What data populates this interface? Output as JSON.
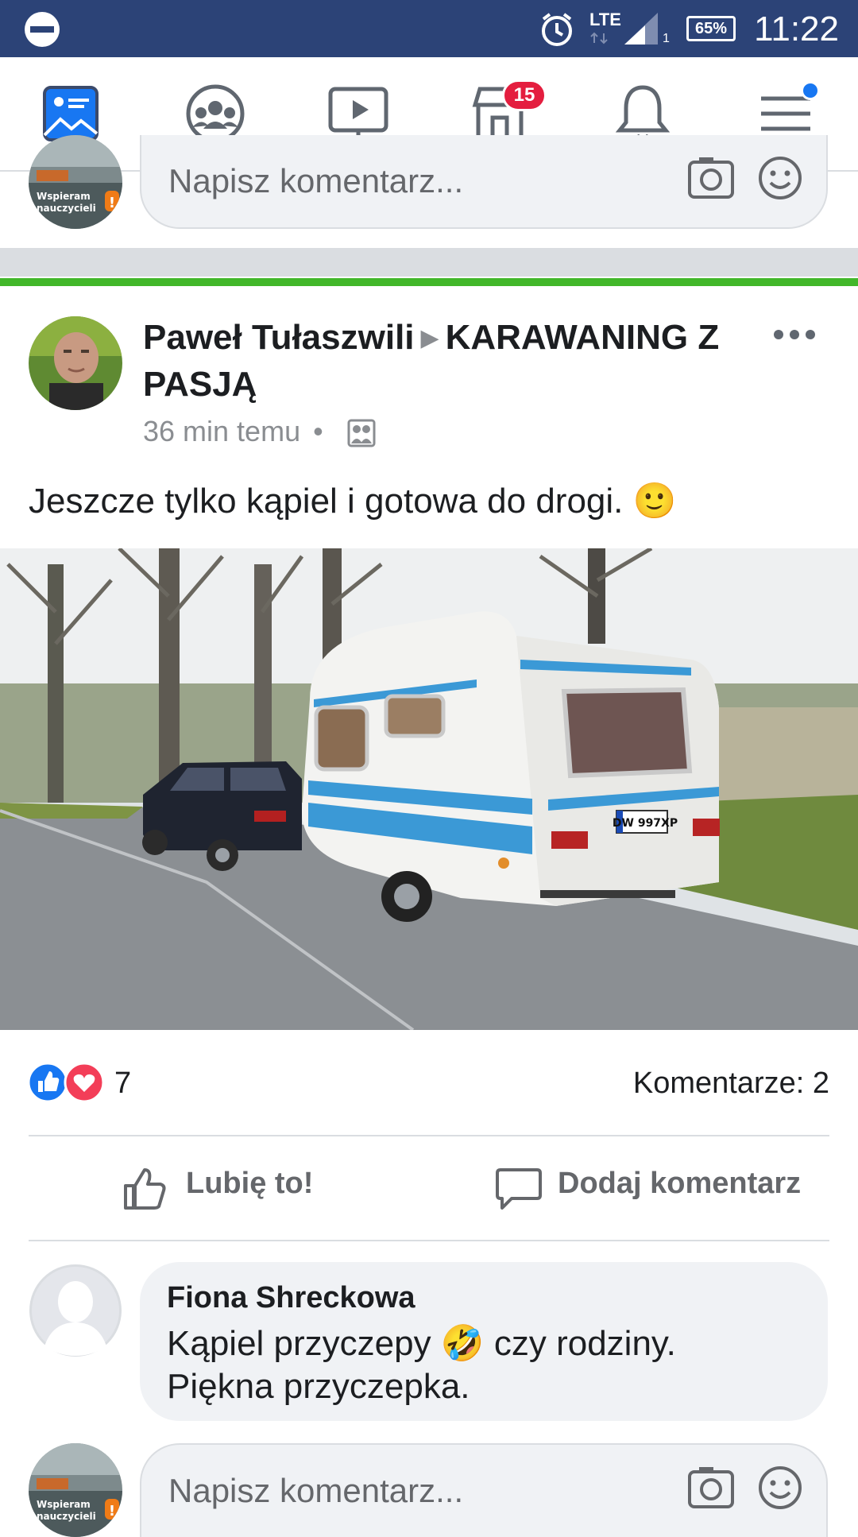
{
  "status_bar": {
    "network": "LTE",
    "sim_slot": "1",
    "battery": "65%",
    "time": "11:22"
  },
  "nav": {
    "marketplace_badge": "15",
    "icons": [
      "news-feed-icon",
      "groups-icon",
      "watch-icon",
      "marketplace-icon",
      "notifications-icon",
      "menu-icon"
    ]
  },
  "top_comment_box": {
    "placeholder": "Napisz komentarz..."
  },
  "avatar_sticker": {
    "line1": "Wspieram",
    "line2": "nauczycieli"
  },
  "post": {
    "author": "Paweł Tułaszwili",
    "group": "KARAWANING Z PASJĄ",
    "time": "36 min temu",
    "separator": "•",
    "text": "Jeszcze tylko kąpiel i gotowa do drogi. 🙂",
    "image_plate": "DW 997XP",
    "reaction_count": "7",
    "comment_count": "Komentarze: 2",
    "like_label": "Lubię to!",
    "comment_label": "Dodaj komentarz"
  },
  "comment": {
    "author": "Fiona Shreckowa",
    "line1_a": "Kąpiel przyczepy ",
    "line1_emoji": "🤣",
    "line1_b": " czy rodziny.",
    "line2": "Piękna przyczepka."
  },
  "bottom_comment_box": {
    "placeholder": "Napisz komentarz..."
  },
  "colors": {
    "status_bar": "#2c4377",
    "brand_blue": "#1877f2",
    "badge_red": "#e41e3f",
    "group_bar_green": "#42b72a"
  }
}
